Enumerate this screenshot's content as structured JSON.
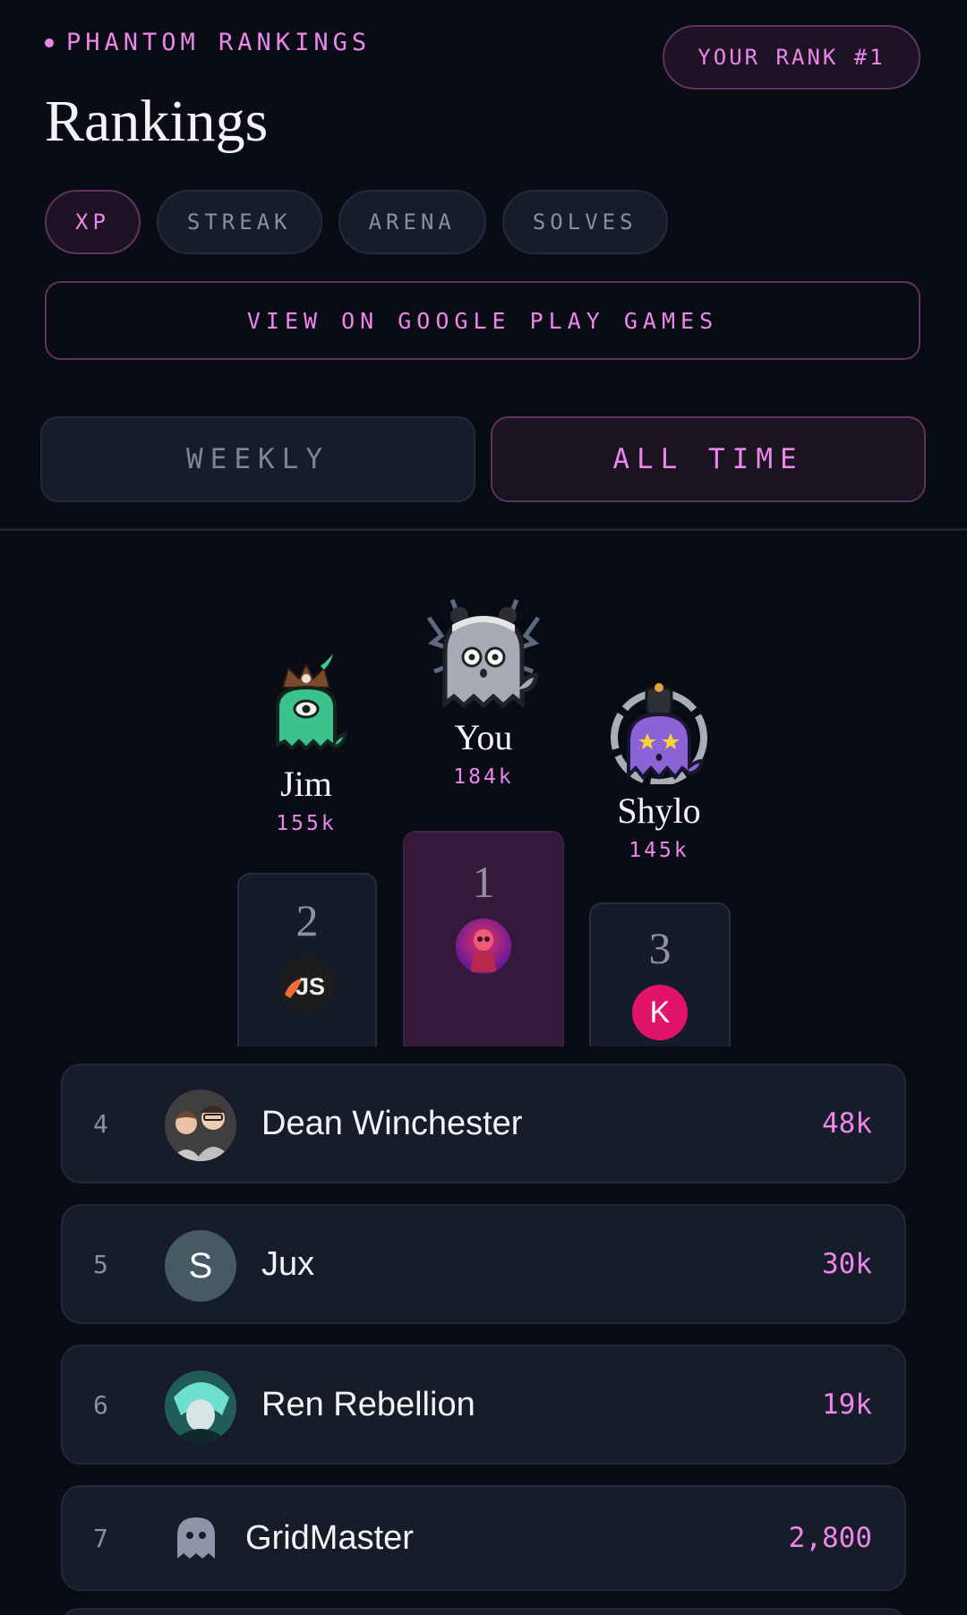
{
  "header": {
    "eyebrow": "PHANTOM RANKINGS",
    "rank_pill": "YOUR RANK #1",
    "title": "Rankings"
  },
  "stat_tabs": [
    {
      "label": "XP",
      "active": true
    },
    {
      "label": "STREAK",
      "active": false
    },
    {
      "label": "ARENA",
      "active": false
    },
    {
      "label": "SOLVES",
      "active": false
    }
  ],
  "google_play_button": "VIEW ON GOOGLE PLAY GAMES",
  "period": {
    "weekly": "WEEKLY",
    "all_time": "ALL TIME",
    "selected": "ALL TIME"
  },
  "podium": {
    "second": {
      "name": "Jim",
      "score": "155k",
      "rank": "2",
      "avatar": "JS-logo",
      "ghost": "green-pirate-ghost"
    },
    "first": {
      "name": "You",
      "score": "184k",
      "rank": "1",
      "avatar": "red-skull-photo",
      "ghost": "grey-panda-ghost"
    },
    "third": {
      "name": "Shylo",
      "score": "145k",
      "rank": "3",
      "avatar": "K",
      "ghost": "purple-crowned-ghost"
    }
  },
  "rows": [
    {
      "rank": "4",
      "name": "Dean Winchester",
      "score": "48k",
      "avatar": "photo-two-kids"
    },
    {
      "rank": "5",
      "name": "Jux",
      "score": "30k",
      "avatar_letter": "S"
    },
    {
      "rank": "6",
      "name": "Ren Rebellion",
      "score": "19k",
      "avatar": "teal-anime-photo"
    },
    {
      "rank": "7",
      "name": "GridMaster",
      "score": "2,800",
      "avatar": "ghost-icon"
    }
  ],
  "colors": {
    "background": "#090c15",
    "accent": "#ee86ea",
    "card": "#171c2b",
    "first_place": "#35193a",
    "k_avatar": "#e0146b",
    "s_avatar": "#455a64"
  }
}
